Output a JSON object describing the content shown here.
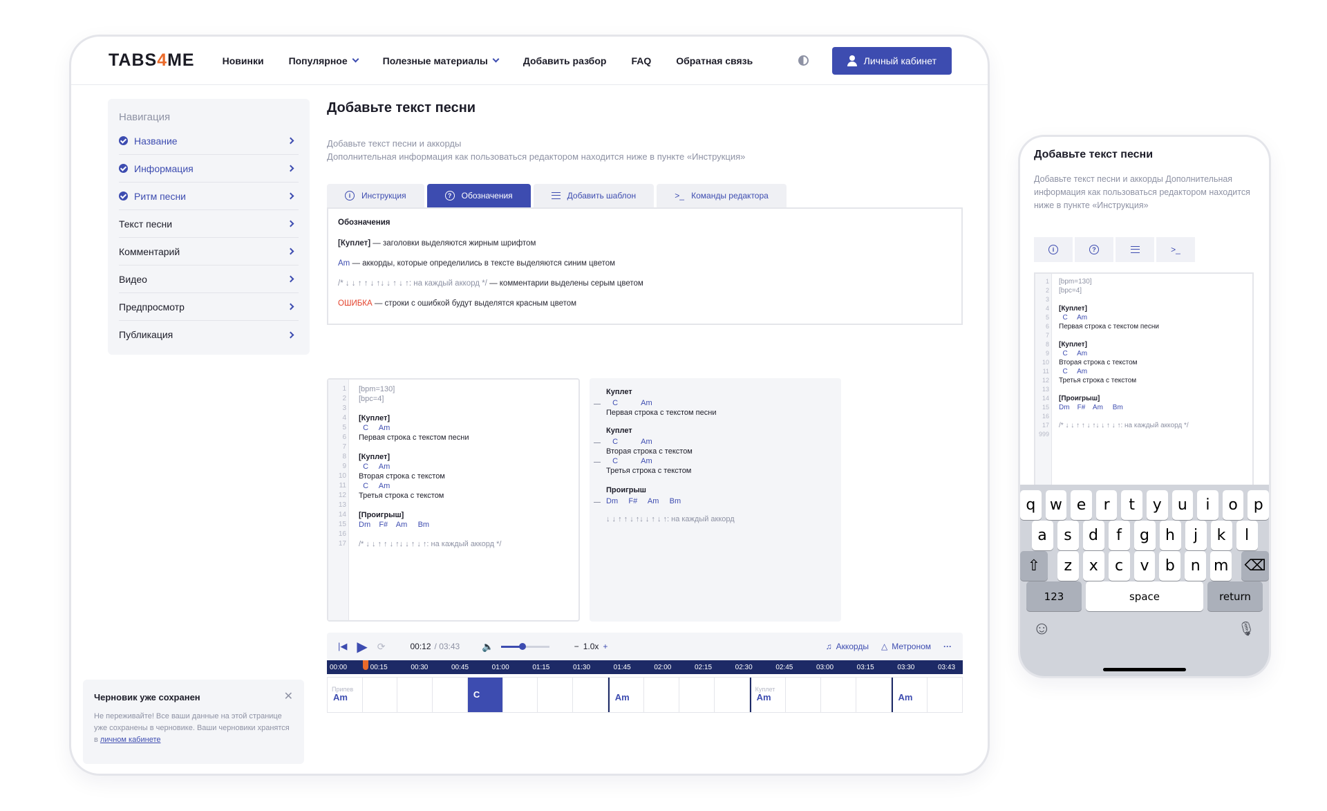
{
  "header": {
    "logo_part1": "TABS",
    "logo_part2": "4",
    "logo_part3": "ME",
    "nav": [
      "Новинки",
      "Популярное",
      "Полезные материалы",
      "Добавить разбор",
      "FAQ",
      "Обратная связь"
    ],
    "cabinet_button": "Личный кабинет"
  },
  "sidebar": {
    "title": "Навигация",
    "items": [
      {
        "label": "Название",
        "done": true
      },
      {
        "label": "Информация",
        "done": true
      },
      {
        "label": "Ритм песни",
        "done": true
      },
      {
        "label": "Текст песни",
        "done": false
      },
      {
        "label": "Комментарий",
        "done": false
      },
      {
        "label": "Видео",
        "done": false
      },
      {
        "label": "Предпросмотр",
        "done": false
      },
      {
        "label": "Публикация",
        "done": false
      }
    ]
  },
  "main": {
    "title": "Добавьте текст песни",
    "subtitle_1": "Добавьте текст песни и аккорды",
    "subtitle_2": "Дополнительная информация как пользоваться редактором находится ниже в пункте «Инструкция»",
    "tabs": [
      "Инструкция",
      "Обозначения",
      "Добавить шаблон",
      "Команды редактора"
    ],
    "legend": {
      "heading": "Обозначения",
      "l1_key": "[Куплет]",
      "l1_text": " — заголовки выделяются жирным шрифтом",
      "l2_key": "Am",
      "l2_text": " — аккорды, которые определились в тексте выделяются синим цветом",
      "l3_key": "/* ↓ ↓ ↑ ↑ ↓ ↑↓ ↓ ↑ ↓ ↑: на каждый аккорд */",
      "l3_text": " — комментарии выделены серым цветом",
      "l4_key": "ОШИБКА",
      "l4_text": " — строки с ошибкой будут выделятся красным цветом"
    }
  },
  "editor": {
    "lines": [
      {
        "n": "1",
        "t": "[bpm=130]",
        "k": "grey"
      },
      {
        "n": "2",
        "t": "[bpc=4]",
        "k": "grey"
      },
      {
        "n": "3",
        "t": "",
        "k": ""
      },
      {
        "n": "4",
        "t": "[Куплет]",
        "k": "bold"
      },
      {
        "n": "5",
        "t": "  C     Am",
        "k": "blue"
      },
      {
        "n": "6",
        "t": "Первая строка с текстом песни",
        "k": ""
      },
      {
        "n": "7",
        "t": "",
        "k": ""
      },
      {
        "n": "8",
        "t": "[Куплет]",
        "k": "bold"
      },
      {
        "n": "9",
        "t": "  C     Am",
        "k": "blue"
      },
      {
        "n": "10",
        "t": "Вторая строка с текстом",
        "k": ""
      },
      {
        "n": "11",
        "t": "  C     Am",
        "k": "blue"
      },
      {
        "n": "12",
        "t": "Третья строка с текстом",
        "k": ""
      },
      {
        "n": "13",
        "t": "",
        "k": ""
      },
      {
        "n": "14",
        "t": "[Проигрыш]",
        "k": "bold"
      },
      {
        "n": "15",
        "t": "Dm    F#    Am     Bm",
        "k": "blue"
      },
      {
        "n": "16",
        "t": "",
        "k": ""
      },
      {
        "n": "17",
        "t": "/* ↓ ↓ ↑ ↑ ↓ ↑↓ ↓ ↑ ↓ ↑: на каждый аккорд */",
        "k": "grey"
      }
    ]
  },
  "preview": {
    "lines": [
      {
        "t": "Куплет",
        "k": "bold",
        "dash": false
      },
      {
        "t": "   C           Am",
        "k": "blue",
        "dash": true
      },
      {
        "t": "Первая строка с текстом песни",
        "k": "",
        "dash": false
      },
      {
        "t": "Куплет",
        "k": "bold",
        "dash": false
      },
      {
        "t": "   C           Am",
        "k": "blue",
        "dash": true
      },
      {
        "t": "Вторая строка с текстом",
        "k": "",
        "dash": false
      },
      {
        "t": "   C           Am",
        "k": "blue",
        "dash": true
      },
      {
        "t": "Третья строка с текстом",
        "k": "",
        "dash": false
      },
      {
        "t": "Проигрыш",
        "k": "bold",
        "dash": false
      },
      {
        "t": "Dm     F#     Am     Bm",
        "k": "blue",
        "dash": true
      },
      {
        "t": "↓ ↓ ↑ ↑ ↓ ↑↓ ↓ ↑ ↓ ↑: на каждый аккорд",
        "k": "grey",
        "dash": false
      }
    ]
  },
  "player": {
    "time_current": "00:12",
    "time_total": "/ 03:43",
    "volume": 0.45,
    "speed": "1.0x",
    "chords_label": "Аккорды",
    "metronome_label": "Метроном",
    "timeline": [
      "00:00",
      "00:15",
      "00:30",
      "00:45",
      "01:00",
      "01:15",
      "01:30",
      "01:45",
      "02:00",
      "02:15",
      "02:30",
      "02:45",
      "03:00",
      "03:15",
      "03:30",
      "03:43"
    ],
    "cells": [
      {
        "sec": "Припев",
        "chord": "Am",
        "sel": false,
        "mark": false
      },
      {
        "sec": "",
        "chord": "",
        "sel": false,
        "mark": false
      },
      {
        "sec": "",
        "chord": "",
        "sel": false,
        "mark": false
      },
      {
        "sec": "",
        "chord": "",
        "sel": false,
        "mark": false
      },
      {
        "sec": "",
        "chord": "C",
        "sel": true,
        "mark": false
      },
      {
        "sec": "",
        "chord": "",
        "sel": false,
        "mark": false
      },
      {
        "sec": "",
        "chord": "",
        "sel": false,
        "mark": false
      },
      {
        "sec": "",
        "chord": "",
        "sel": false,
        "mark": false
      },
      {
        "sec": "",
        "chord": "Am",
        "sel": false,
        "mark": true
      },
      {
        "sec": "",
        "chord": "",
        "sel": false,
        "mark": false
      },
      {
        "sec": "",
        "chord": "",
        "sel": false,
        "mark": false
      },
      {
        "sec": "",
        "chord": "",
        "sel": false,
        "mark": false
      },
      {
        "sec": "Куплет",
        "chord": "Am",
        "sel": false,
        "mark": true
      },
      {
        "sec": "",
        "chord": "",
        "sel": false,
        "mark": false
      },
      {
        "sec": "",
        "chord": "",
        "sel": false,
        "mark": false
      },
      {
        "sec": "",
        "chord": "",
        "sel": false,
        "mark": false
      },
      {
        "sec": "",
        "chord": "Am",
        "sel": false,
        "mark": true
      },
      {
        "sec": "",
        "chord": "",
        "sel": false,
        "mark": false
      }
    ]
  },
  "toast": {
    "title": "Черновик уже сохранен",
    "text": "Не переживайте! Все ваши данные на этой странице уже сохранены в черновике. Ваши черновики хранятся в ",
    "link": "личном кабинете"
  },
  "phone": {
    "title": "Добавьте текст песни",
    "subtitle": "Добавьте текст песни и аккорды Дополнительная информация как пользоваться редактором находится ниже в пункте «Инструкция»",
    "lines": [
      {
        "n": "1",
        "t": "[bpm=130]",
        "k": "grey"
      },
      {
        "n": "2",
        "t": "[bpc=4]",
        "k": "grey"
      },
      {
        "n": "3",
        "t": "",
        "k": ""
      },
      {
        "n": "4",
        "t": "[Куплет]",
        "k": "bold"
      },
      {
        "n": "5",
        "t": "  C     Am",
        "k": "blue"
      },
      {
        "n": "6",
        "t": "Первая строка с текстом песни",
        "k": ""
      },
      {
        "n": "7",
        "t": "",
        "k": ""
      },
      {
        "n": "8",
        "t": "[Куплет]",
        "k": "bold"
      },
      {
        "n": "9",
        "t": "  C     Am",
        "k": "blue"
      },
      {
        "n": "10",
        "t": "Вторая строка с текстом",
        "k": ""
      },
      {
        "n": "11",
        "t": "  C     Am",
        "k": "blue"
      },
      {
        "n": "12",
        "t": "Третья строка с текстом",
        "k": ""
      },
      {
        "n": "13",
        "t": "",
        "k": ""
      },
      {
        "n": "14",
        "t": "[Проигрыш]",
        "k": "bold"
      },
      {
        "n": "15",
        "t": "Dm    F#    Am     Bm",
        "k": "blue"
      },
      {
        "n": "16",
        "t": "",
        "k": ""
      },
      {
        "n": "17",
        "t": "/* ↓ ↓ ↑ ↑ ↓ ↑↓ ↓ ↑ ↓ ↑: на каждый аккорд */",
        "k": "grey"
      },
      {
        "n": "999",
        "t": "",
        "k": ""
      }
    ],
    "keyboard": {
      "row1": [
        "q",
        "w",
        "e",
        "r",
        "t",
        "y",
        "u",
        "i",
        "o",
        "p"
      ],
      "row2": [
        "a",
        "s",
        "d",
        "f",
        "g",
        "h",
        "j",
        "k",
        "l"
      ],
      "row3": [
        "z",
        "x",
        "c",
        "v",
        "b",
        "n",
        "m"
      ],
      "k123": "123",
      "space": "space",
      "return": "return"
    }
  },
  "colors": {
    "accent": "#3d4cb0",
    "logo_accent": "#ea6a2a",
    "timeline": "#1d2a66",
    "error": "#e3412b"
  }
}
